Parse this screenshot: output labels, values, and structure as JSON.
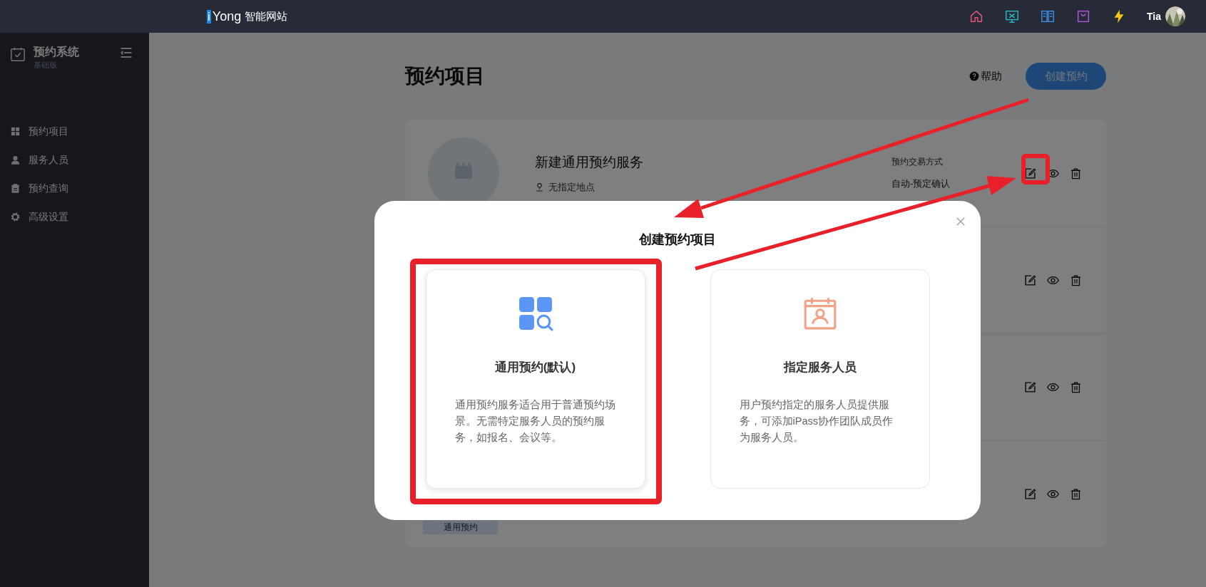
{
  "top_bar": {
    "logo_mark": "i",
    "logo_text": "Yong",
    "site_name": "智能网站",
    "icons": [
      {
        "kind": "home"
      },
      {
        "kind": "monitor"
      },
      {
        "kind": "book"
      },
      {
        "kind": "bag"
      },
      {
        "kind": "bolt"
      }
    ],
    "user": "Tia"
  },
  "sidebar": {
    "title": "预约系统",
    "subtitle": "基础版",
    "items": [
      {
        "label": "预约项目",
        "kind": "grid"
      },
      {
        "label": "服务人员",
        "kind": "person"
      },
      {
        "label": "预约查询",
        "kind": "clipboard"
      },
      {
        "label": "高级设置",
        "kind": "gear"
      }
    ]
  },
  "page": {
    "title": "预约项目",
    "help": "帮助",
    "create_button": "创建预约"
  },
  "rows": [
    {
      "title": "新建通用预约服务",
      "location": "无指定地点",
      "column_label": "预约交易方式",
      "column_value": "自动-预定确认"
    },
    {},
    {},
    {
      "tag": "通用预约"
    }
  ],
  "modal": {
    "title": "创建预约项目",
    "options": [
      {
        "kind": "general",
        "title": "通用预约(默认)",
        "description": "通用预约服务适合用于普通预约场景。无需特定服务人员的预约服务，如报名、会议等。"
      },
      {
        "kind": "staff",
        "title": "指定服务人员",
        "description": "用户预约指定的服务人员提供服务，可添加iPass协作团队成员作为服务人员。"
      }
    ]
  }
}
